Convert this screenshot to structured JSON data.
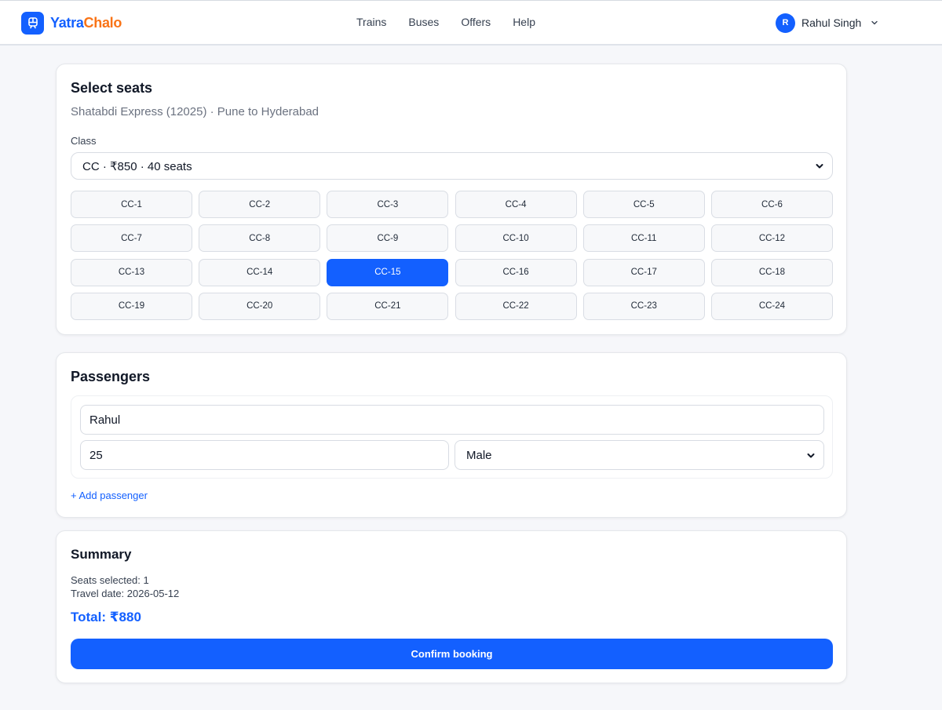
{
  "header": {
    "brand_part1": "Yatra",
    "brand_part2": "Chalo",
    "nav": [
      "Trains",
      "Buses",
      "Offers",
      "Help"
    ],
    "user": {
      "initial": "R",
      "name": "Rahul Singh"
    }
  },
  "seat_selection": {
    "title": "Select seats",
    "subtitle": "Shatabdi Express (12025) · Pune to Hyderabad",
    "class_label": "Class",
    "class_value": "CC · ₹850 · 40 seats",
    "seats": [
      "CC-1",
      "CC-2",
      "CC-3",
      "CC-4",
      "CC-5",
      "CC-6",
      "CC-7",
      "CC-8",
      "CC-9",
      "CC-10",
      "CC-11",
      "CC-12",
      "CC-13",
      "CC-14",
      "CC-15",
      "CC-16",
      "CC-17",
      "CC-18",
      "CC-19",
      "CC-20",
      "CC-21",
      "CC-22",
      "CC-23",
      "CC-24"
    ],
    "selected_seat": "CC-15"
  },
  "passengers": {
    "title": "Passengers",
    "list": [
      {
        "name": "Rahul",
        "age": "25",
        "gender": "Male"
      }
    ],
    "add_label": "+ Add passenger"
  },
  "summary": {
    "title": "Summary",
    "seats_selected": "Seats selected: 1",
    "travel_date": "Travel date: 2026-05-12",
    "total": "Total: ₹880",
    "confirm_label": "Confirm booking"
  },
  "colors": {
    "accent": "#1360ff",
    "brand_orange": "#f97316",
    "page_bg": "#f6f7fa"
  }
}
